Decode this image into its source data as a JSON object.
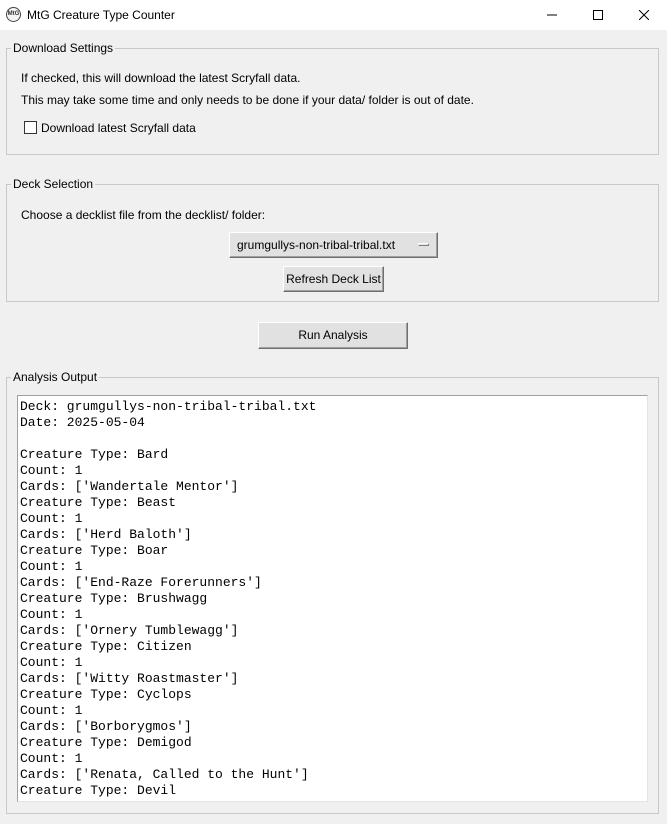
{
  "window": {
    "title": "MtG Creature Type Counter",
    "icon_text": "MtG"
  },
  "download_settings": {
    "legend": "Download Settings",
    "info_line1": "If checked, this will download the latest Scryfall data.",
    "info_line2": "This may take some time and only needs to be done if your data/ folder is out of date.",
    "checkbox_label": "Download latest Scryfall data",
    "checked": false
  },
  "deck_selection": {
    "legend": "Deck Selection",
    "prompt": "Choose a decklist file from the decklist/ folder:",
    "selected_deck": "grumgullys-non-tribal-tribal.txt",
    "refresh_label": "Refresh Deck List"
  },
  "run_button_label": "Run Analysis",
  "analysis_output": {
    "legend": "Analysis Output",
    "lines": [
      "Deck: grumgullys-non-tribal-tribal.txt",
      "Date: 2025-05-04",
      "",
      "Creature Type: Bard",
      "Count: 1",
      "Cards: ['Wandertale Mentor']",
      "Creature Type: Beast",
      "Count: 1",
      "Cards: ['Herd Baloth']",
      "Creature Type: Boar",
      "Count: 1",
      "Cards: ['End-Raze Forerunners']",
      "Creature Type: Brushwagg",
      "Count: 1",
      "Cards: ['Ornery Tumblewagg']",
      "Creature Type: Citizen",
      "Count: 1",
      "Cards: ['Witty Roastmaster']",
      "Creature Type: Cyclops",
      "Count: 1",
      "Cards: ['Borborygmos']",
      "Creature Type: Demigod",
      "Count: 1",
      "Cards: ['Renata, Called to the Hunt']",
      "Creature Type: Devil"
    ]
  }
}
